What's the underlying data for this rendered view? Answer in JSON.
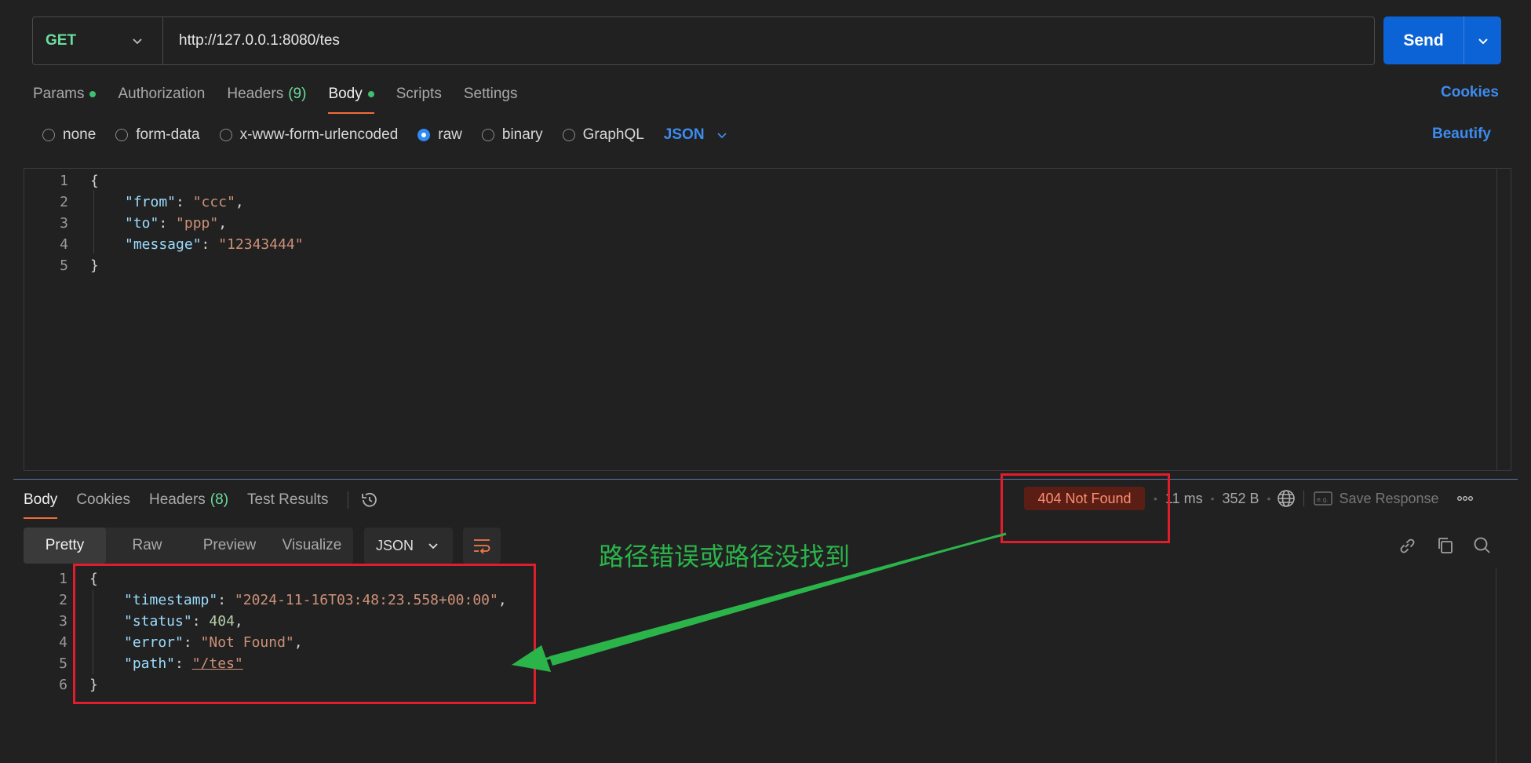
{
  "request": {
    "method": "GET",
    "url": "http://127.0.0.1:8080/tes",
    "send_label": "Send",
    "tabs": [
      {
        "label": "Params",
        "count": "",
        "dot": true
      },
      {
        "label": "Authorization",
        "count": "",
        "dot": false
      },
      {
        "label": "Headers",
        "count": "(9)",
        "dot": false
      },
      {
        "label": "Body",
        "count": "",
        "dot": true,
        "active": true
      },
      {
        "label": "Scripts",
        "count": "",
        "dot": false
      },
      {
        "label": "Settings",
        "count": "",
        "dot": false
      }
    ],
    "cookies_label": "Cookies",
    "body_types": [
      "none",
      "form-data",
      "x-www-form-urlencoded",
      "raw",
      "binary",
      "GraphQL"
    ],
    "selected_body_type": "raw",
    "language": "JSON",
    "beautify_label": "Beautify",
    "body_lines": [
      {
        "n": "1",
        "text": "{"
      },
      {
        "n": "2",
        "key": "\"from\"",
        "val": "\"ccc\"",
        "end": ","
      },
      {
        "n": "3",
        "key": "\"to\"",
        "val": "\"ppp\"",
        "end": ","
      },
      {
        "n": "4",
        "key": "\"message\"",
        "val": "\"12343444\"",
        "end": ""
      },
      {
        "n": "5",
        "text": "}"
      }
    ]
  },
  "response": {
    "tabs": [
      {
        "label": "Body",
        "count": "",
        "active": true
      },
      {
        "label": "Cookies",
        "count": ""
      },
      {
        "label": "Headers",
        "count": "(8)"
      },
      {
        "label": "Test Results",
        "count": ""
      }
    ],
    "status": "404 Not Found",
    "time": "11 ms",
    "size": "352 B",
    "save_label": "Save Response",
    "format_tabs": [
      "Pretty",
      "Raw",
      "Preview",
      "Visualize"
    ],
    "active_format": "Pretty",
    "language": "JSON",
    "body_lines": [
      {
        "n": "1",
        "text": "{"
      },
      {
        "n": "2",
        "key": "\"timestamp\"",
        "val": "\"2024-11-16T03:48:23.558+00:00\"",
        "end": ",",
        "type": "s"
      },
      {
        "n": "3",
        "key": "\"status\"",
        "val": "404",
        "end": ",",
        "type": "n"
      },
      {
        "n": "4",
        "key": "\"error\"",
        "val": "\"Not Found\"",
        "end": ",",
        "type": "s"
      },
      {
        "n": "5",
        "key": "\"path\"",
        "val": "\"/tes\"",
        "end": "",
        "type": "s"
      },
      {
        "n": "6",
        "text": "}"
      }
    ]
  },
  "annotation": {
    "text": "路径错误或路径没找到",
    "color": "#2bb44a",
    "box_color": "#e21d2b"
  }
}
